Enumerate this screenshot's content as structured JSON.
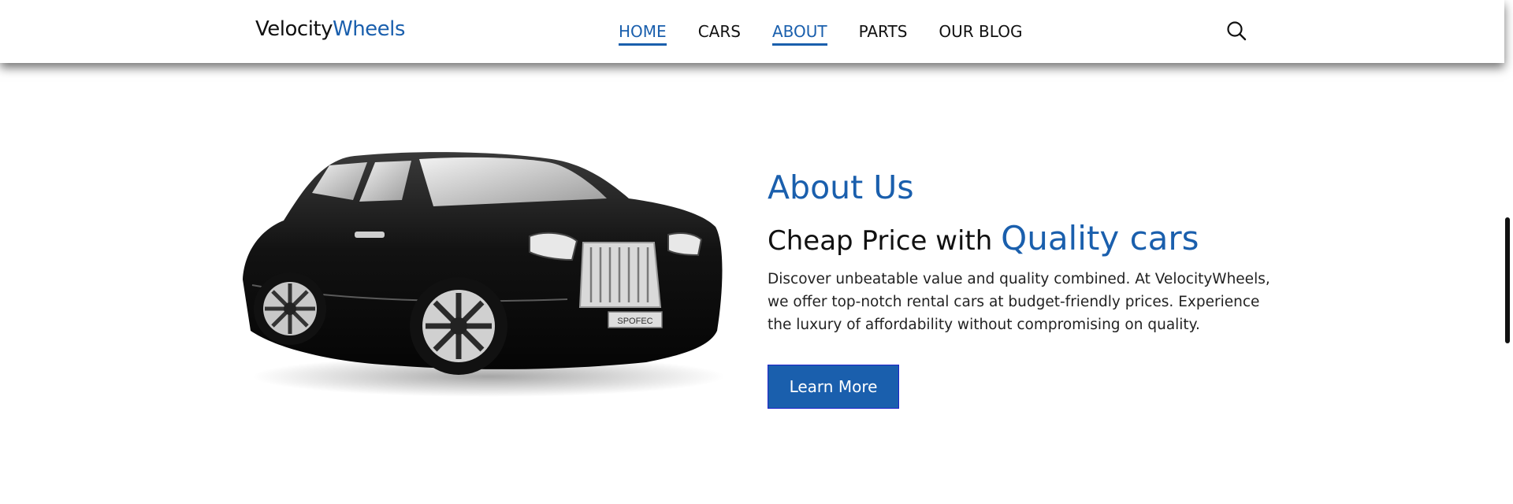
{
  "brand": {
    "name_part1": "Velocity",
    "name_part2": "Wheels",
    "accent_color": "#1a5fad"
  },
  "nav": {
    "items": [
      {
        "label": "HOME"
      },
      {
        "label": "CARS"
      },
      {
        "label": "ABOUT"
      },
      {
        "label": "PARTS"
      },
      {
        "label": "OUR BLOG"
      }
    ],
    "search_icon": "search-icon"
  },
  "about": {
    "title": "About Us",
    "headline_plain": "Cheap Price with",
    "headline_accent": "Quality cars",
    "description": "Discover unbeatable value and quality combined. At VelocityWheels, we offer top-notch rental cars at budget-friendly prices. Experience the luxury of affordability without compromising on quality.",
    "cta_label": "Learn More",
    "plate_text": "SPOFEC"
  }
}
